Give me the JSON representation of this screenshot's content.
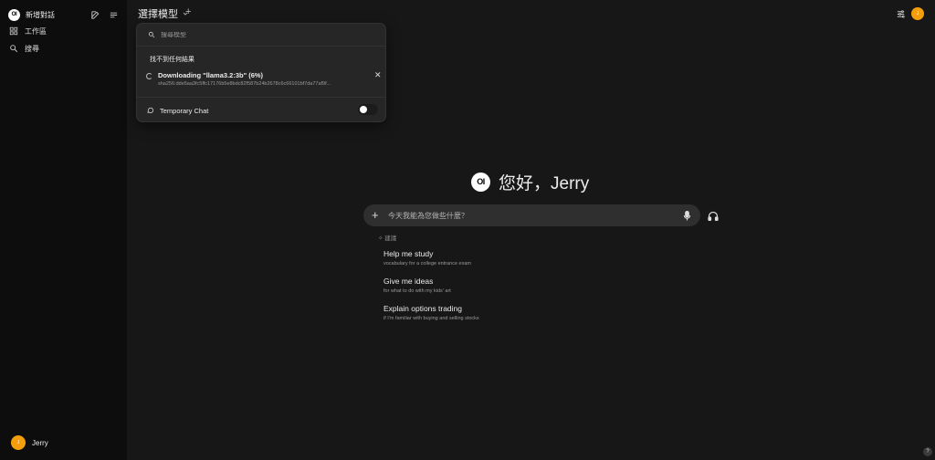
{
  "sidebar": {
    "logo_text": "OI",
    "new_chat_label": "新增對話",
    "items": [
      {
        "label": "工作區",
        "icon": "grid-icon"
      },
      {
        "label": "搜尋",
        "icon": "search-icon"
      }
    ],
    "user": {
      "name": "Jerry",
      "avatar_initial": "J",
      "avatar_color": "#f59e0b"
    }
  },
  "topbar": {
    "model_selector_label": "選擇模型",
    "add_model": "+",
    "avatar_initial": "J"
  },
  "dropdown": {
    "search_placeholder": "搜尋模型",
    "no_results": "找不到任何結果",
    "download": {
      "title": "Downloading \"llama3.2:3b\" (6%)",
      "progress_percent": 6,
      "hash": "sha256:dde5aa3fc5ffc17176b5e8bdc82f587b24b2678c6c66101bf7da77af9f..."
    },
    "temporary_chat_label": "Temporary Chat",
    "temporary_chat_enabled": false
  },
  "main": {
    "logo_text": "OI",
    "greeting": "您好，Jerry",
    "input_placeholder": "今天我能為您做些什麼？",
    "plus": "+",
    "suggestions_label": "建議",
    "suggestions": [
      {
        "title": "Help me study",
        "subtitle": "vocabulary for a college entrance exam"
      },
      {
        "title": "Give me ideas",
        "subtitle": "for what to do with my kids' art"
      },
      {
        "title": "Explain options trading",
        "subtitle": "if I'm familiar with buying and selling stocks"
      }
    ]
  },
  "help_label": "?",
  "colors": {
    "accent": "#f59e0b",
    "background": "#171717",
    "sidebar": "#0d0d0d"
  }
}
